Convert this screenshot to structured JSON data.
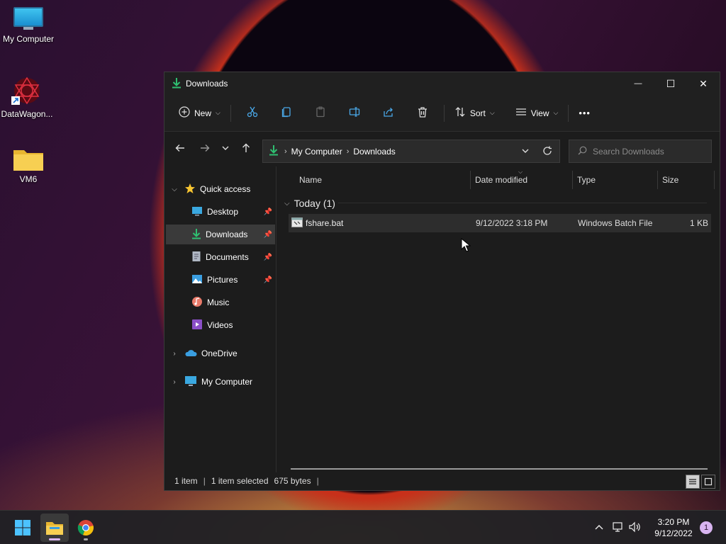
{
  "desktop": {
    "icons": [
      {
        "label": "My Computer",
        "icon": "monitor-icon"
      },
      {
        "label": "DataWagon...",
        "icon": "datawagon-shortcut-icon"
      },
      {
        "label": "VM6",
        "icon": "folder-icon"
      }
    ]
  },
  "window": {
    "title": "Downloads",
    "controls": {
      "minimize": "—",
      "maximize": "☐",
      "close": "✕"
    }
  },
  "toolbar": {
    "new_label": "New",
    "sort_label": "Sort",
    "view_label": "View",
    "actions": [
      "cut-icon",
      "copy-icon",
      "paste-icon",
      "rename-icon",
      "share-icon",
      "delete-icon"
    ],
    "more": "•••"
  },
  "address": {
    "breadcrumbs": [
      "My Computer",
      "Downloads"
    ]
  },
  "search": {
    "placeholder": "Search Downloads"
  },
  "sidebar": {
    "quick_access": "Quick access",
    "items": [
      {
        "label": "Desktop",
        "pinned": true
      },
      {
        "label": "Downloads",
        "pinned": true,
        "selected": true
      },
      {
        "label": "Documents",
        "pinned": true
      },
      {
        "label": "Pictures",
        "pinned": true
      },
      {
        "label": "Music",
        "pinned": false
      },
      {
        "label": "Videos",
        "pinned": false
      }
    ],
    "onedrive": "OneDrive",
    "my_computer": "My Computer"
  },
  "file_list": {
    "columns": [
      "Name",
      "Date modified",
      "Type",
      "Size"
    ],
    "group": "Today (1)",
    "rows": [
      {
        "name": "fshare.bat",
        "date": "9/12/2022 3:18 PM",
        "type": "Windows Batch File",
        "size": "1 KB"
      }
    ]
  },
  "status": {
    "count": "1 item",
    "selected": "1 item selected",
    "bytes": "675 bytes"
  },
  "taskbar": {
    "apps": [
      "start-icon",
      "file-explorer-icon",
      "chrome-icon"
    ],
    "time": "3:20 PM",
    "date": "9/12/2022",
    "notifications": "1"
  },
  "colors": {
    "accent_green": "#2fbf71",
    "window_bg": "#1c1c1c",
    "selected_row": "#2d2d2d"
  }
}
